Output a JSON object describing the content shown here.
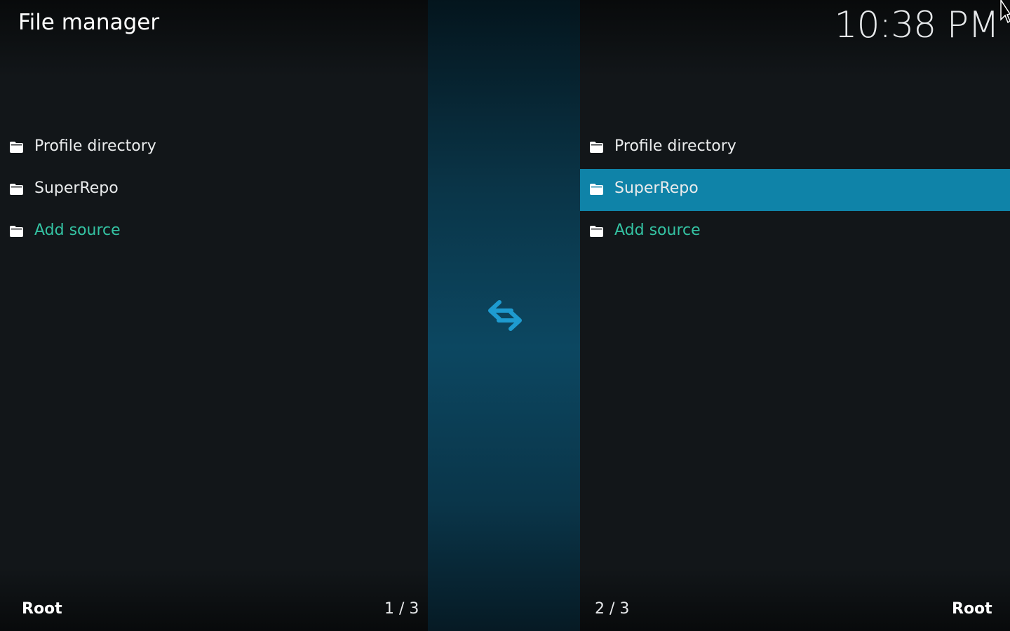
{
  "header": {
    "title": "File manager",
    "clock": "10:38 PM"
  },
  "left_pane": {
    "items": [
      {
        "label": "Profile directory",
        "icon": "folder-icon",
        "type": "source"
      },
      {
        "label": "SuperRepo",
        "icon": "folder-icon",
        "type": "source"
      },
      {
        "label": "Add source",
        "icon": "folder-icon",
        "type": "action"
      }
    ],
    "footer_path": "Root",
    "footer_count": "1 / 3"
  },
  "right_pane": {
    "items": [
      {
        "label": "Profile directory",
        "icon": "folder-icon",
        "type": "source"
      },
      {
        "label": "SuperRepo",
        "icon": "folder-icon",
        "type": "source",
        "selected": true
      },
      {
        "label": "Add source",
        "icon": "folder-icon",
        "type": "action"
      }
    ],
    "footer_path": "Root",
    "footer_count": "2 / 3"
  },
  "divider": {
    "icon": "swap-arrows-icon"
  },
  "colors": {
    "background": "#121619",
    "accent_text": "#34c3a3",
    "selection": "#0f83a8",
    "divider": "#0c4761",
    "swap_icon": "#1e9bd0"
  }
}
